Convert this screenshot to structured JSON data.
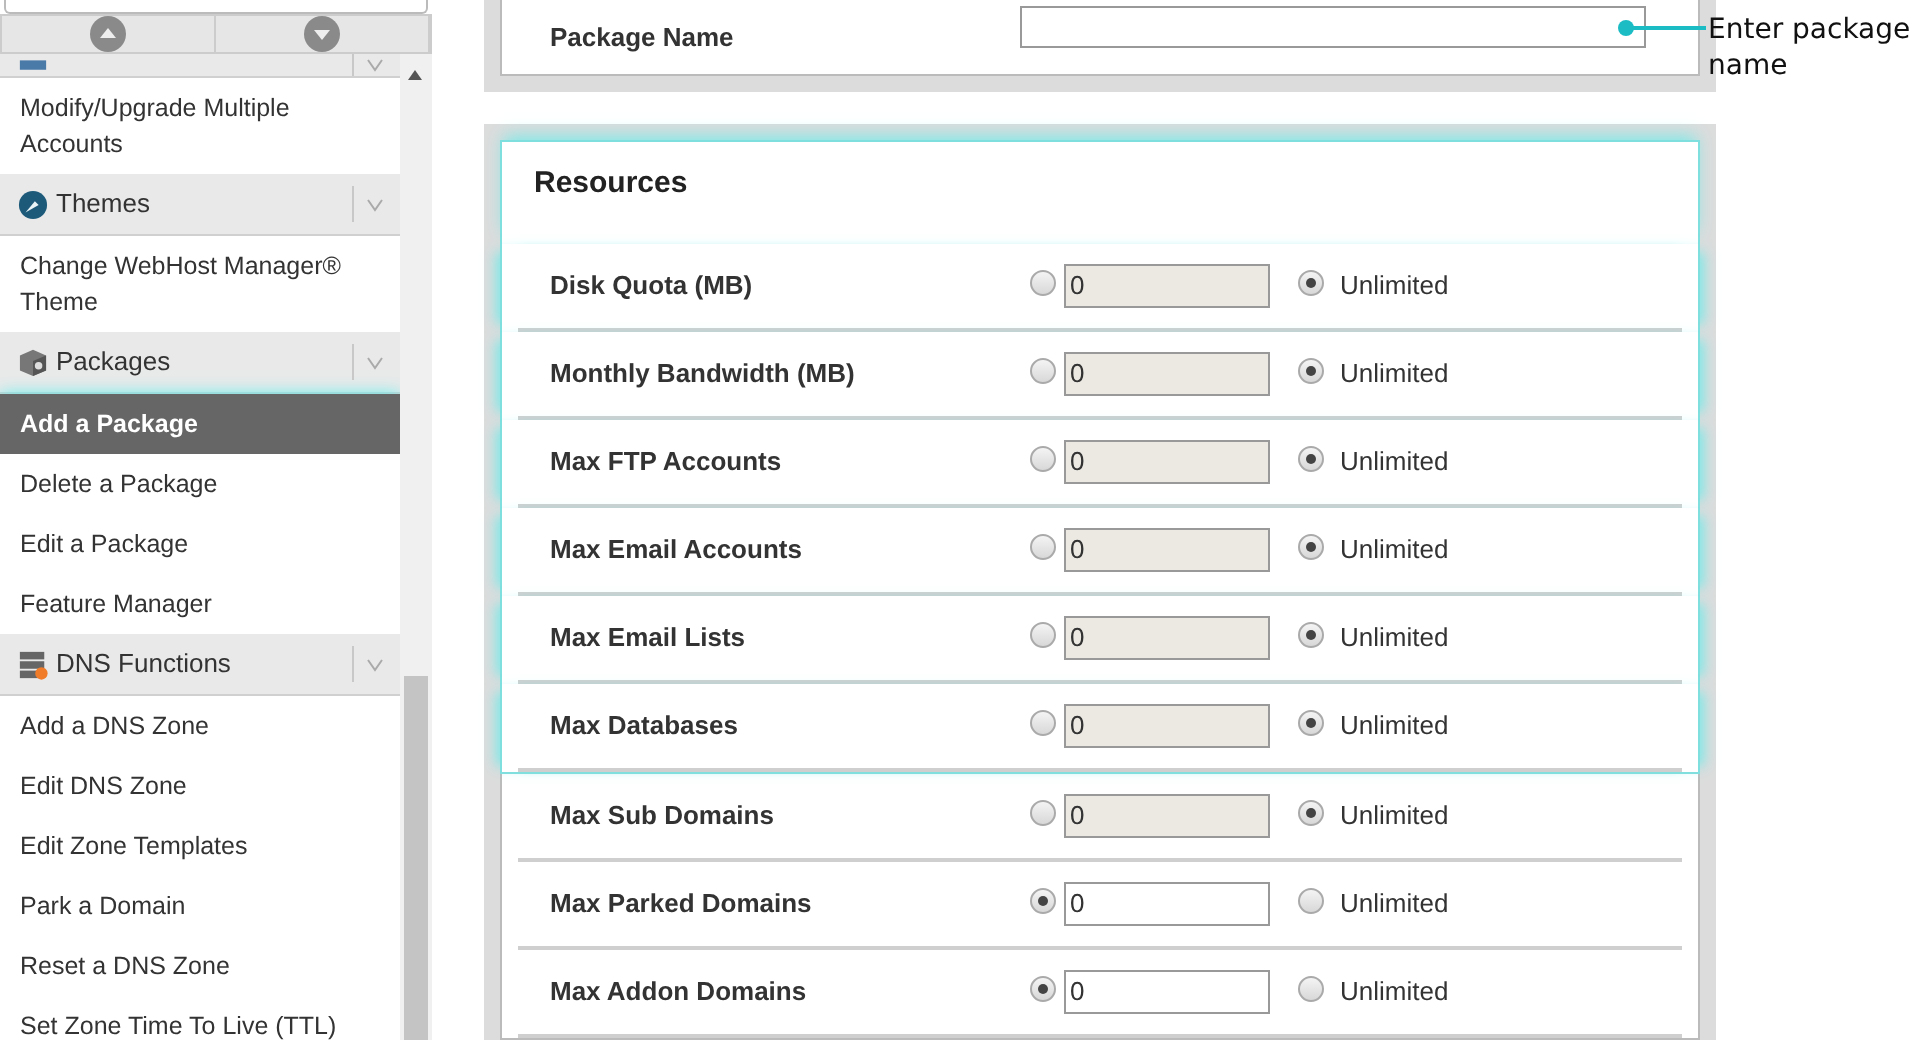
{
  "sidebar": {
    "nav_buttons": [
      {
        "kind": "up"
      },
      {
        "kind": "down"
      }
    ],
    "sections": [
      {
        "items": [
          {
            "label": "Modify/Upgrade Multiple Accounts",
            "selected": false
          }
        ]
      },
      {
        "title": "Themes",
        "items": [
          {
            "label": "Change WebHost Manager® Theme",
            "selected": false
          }
        ]
      },
      {
        "title": "Packages",
        "items": [
          {
            "label": "Add a Package",
            "selected": true
          },
          {
            "label": "Delete a Package",
            "selected": false
          },
          {
            "label": "Edit a Package",
            "selected": false
          },
          {
            "label": "Feature Manager",
            "selected": false
          }
        ]
      },
      {
        "title": "DNS Functions",
        "items": [
          {
            "label": "Add a DNS Zone",
            "selected": false
          },
          {
            "label": "Edit DNS Zone",
            "selected": false
          },
          {
            "label": "Edit Zone Templates",
            "selected": false
          },
          {
            "label": "Park a Domain",
            "selected": false
          },
          {
            "label": "Reset a DNS Zone",
            "selected": false
          },
          {
            "label": "Set Zone Time To Live (TTL)",
            "selected": false
          }
        ]
      }
    ]
  },
  "package": {
    "label": "Package Name",
    "annotation": "Enter package name"
  },
  "resources": {
    "title": "Resources",
    "rows": [
      {
        "label": "Disk Quota (MB)",
        "value": "0",
        "unlimited": true,
        "unlimited_label": "Unlimited",
        "highlighted": true
      },
      {
        "label": "Monthly Bandwidth (MB)",
        "value": "0",
        "unlimited": true,
        "unlimited_label": "Unlimited",
        "highlighted": true
      },
      {
        "label": "Max FTP Accounts",
        "value": "0",
        "unlimited": true,
        "unlimited_label": "Unlimited",
        "highlighted": true
      },
      {
        "label": "Max Email Accounts",
        "value": "0",
        "unlimited": true,
        "unlimited_label": "Unlimited",
        "highlighted": true
      },
      {
        "label": "Max Email Lists",
        "value": "0",
        "unlimited": true,
        "unlimited_label": "Unlimited",
        "highlighted": true
      },
      {
        "label": "Max Databases",
        "value": "0",
        "unlimited": true,
        "unlimited_label": "Unlimited",
        "highlighted": true
      },
      {
        "label": "Max Sub Domains",
        "value": "0",
        "unlimited": true,
        "unlimited_label": "Unlimited",
        "highlighted": false
      },
      {
        "label": "Max Parked Domains",
        "value": "0",
        "unlimited": false,
        "unlimited_label": "Unlimited",
        "highlighted": false
      },
      {
        "label": "Max Addon Domains",
        "value": "0",
        "unlimited": false,
        "unlimited_label": "Unlimited",
        "highlighted": false
      }
    ]
  }
}
